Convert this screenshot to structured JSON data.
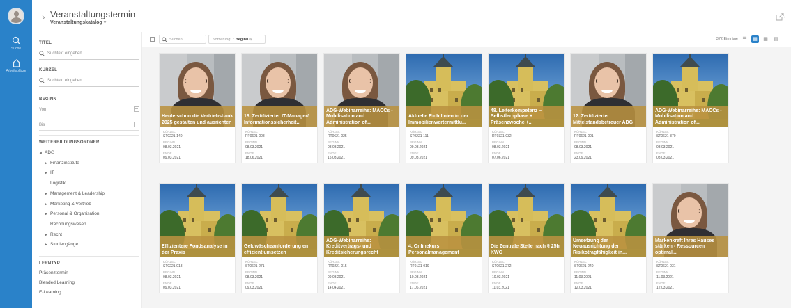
{
  "nav": {
    "search_label": "Suche",
    "workspace_label": "Arbeitsplätze"
  },
  "header": {
    "title": "Veranstaltungstermin",
    "subtitle": "Veranstaltungskatalog"
  },
  "filters": {
    "title_label": "TITEL",
    "title_placeholder": "Suchtext eingeben...",
    "kuerzel_label": "KÜRZEL",
    "kuerzel_placeholder": "Suchtext eingeben...",
    "begin_label": "BEGINN",
    "from_label": "Von",
    "to_label": "Bis",
    "folder_label": "WEITERBILDUNGSORDNER",
    "tree": [
      {
        "label": "ADG",
        "arrow": "◢",
        "level": 0
      },
      {
        "label": "Finanzinstitute",
        "arrow": "▶",
        "level": 1
      },
      {
        "label": "IT",
        "arrow": "▶",
        "level": 1
      },
      {
        "label": "Logistik",
        "arrow": "",
        "level": 1
      },
      {
        "label": "Management & Leadership",
        "arrow": "▶",
        "level": 1
      },
      {
        "label": "Marketing & Vertrieb",
        "arrow": "▶",
        "level": 1
      },
      {
        "label": "Personal & Organisation",
        "arrow": "▶",
        "level": 1
      },
      {
        "label": "Rechnungswesen",
        "arrow": "",
        "level": 1
      },
      {
        "label": "Recht",
        "arrow": "▶",
        "level": 1
      },
      {
        "label": "Studiengänge",
        "arrow": "▶",
        "level": 1
      }
    ],
    "lerntyp_label": "LERNTYP",
    "lerntyp_items": [
      "Präsenztermin",
      "Blended Learning",
      "E-Learning"
    ]
  },
  "toolbar": {
    "search_placeholder": "Suchen...",
    "sort_label": "Sortierung:",
    "sort_value": "↑ Beginn",
    "sort_clear": "⊗",
    "count": "372 Einträge"
  },
  "labels": {
    "kuerzel": "KÜRZEL",
    "beginn": "BEGINN",
    "ende": "ENDE"
  },
  "cards": [
    {
      "title": "Heute schon die Vertriebsbank 2025 gestalten und ausrichten",
      "scene": "person",
      "kuerzel": "ST0221-140",
      "beginn": "08.03.2021",
      "ende": "09.03.2021"
    },
    {
      "title": "18. Zertifizierter IT-Manager/ Informationssicherheit...",
      "scene": "person",
      "kuerzel": "RT0621-008",
      "beginn": "08.03.2021",
      "ende": "18.06.2021"
    },
    {
      "title": "ADG-Webinarreihe: MACCs - Mobilisation and Administration of...",
      "scene": "person",
      "kuerzel": "RT0621-025",
      "beginn": "08.03.2021",
      "ende": "15.03.2021"
    },
    {
      "title": "Aktuelle Richtlinien in der Immobilienwertermittlu...",
      "scene": "castle",
      "kuerzel": "ST0221-111",
      "beginn": "09.03.2021",
      "ende": "09.03.2021"
    },
    {
      "title": "48. Leiterkompetenz – Selbstlernphase + Präsenzwoche +...",
      "scene": "castle",
      "kuerzel": "RT0321-032",
      "beginn": "08.03.2021",
      "ende": "07.06.2021"
    },
    {
      "title": "12. Zertifizierter Mittelstandsbetreuer ADG",
      "scene": "person",
      "kuerzel": "RT0621-001",
      "beginn": "08.03.2021",
      "ende": "23.09.2021"
    },
    {
      "title": "ADG-Webinarreihe: MACCs - Mobilisation and Administration of...",
      "scene": "castle",
      "kuerzel": "ST0621-370",
      "beginn": "08.03.2021",
      "ende": "08.03.2021"
    },
    {
      "title": "Effizientere Fondsanalyse in der Praxis",
      "scene": "castle",
      "kuerzel": "ST0221-018",
      "beginn": "08.03.2021",
      "ende": "09.03.2021"
    },
    {
      "title": "Geldwäscheanforderung en effizient umsetzen",
      "scene": "castle",
      "kuerzel": "ST0621-271",
      "beginn": "08.03.2021",
      "ende": "09.03.2021"
    },
    {
      "title": "ADG-Webinarreihe: Kreditvertrags- und Kreditsicherungsrecht",
      "scene": "castle",
      "kuerzel": "RT0221-015",
      "beginn": "09.03.2021",
      "ende": "14.04.2021"
    },
    {
      "title": "4. Onlinekurs Personalmanagement",
      "scene": "castle",
      "kuerzel": "RT0121-019",
      "beginn": "10.03.2021",
      "ende": "17.06.2021"
    },
    {
      "title": "Die Zentrale Stelle nach § 25h KWG",
      "scene": "castle",
      "kuerzel": "ST0621-272",
      "beginn": "10.03.2021",
      "ende": "11.03.2021"
    },
    {
      "title": "Umsetzung der Neuausrichtung der Risikotragfähigkeit in...",
      "scene": "castle",
      "kuerzel": "ST0621-240",
      "beginn": "11.03.2021",
      "ende": "12.03.2021"
    },
    {
      "title": "Markenkraft Ihres Hauses stärken - Ressourcen optimal...",
      "scene": "person",
      "kuerzel": "ST0621-031",
      "beginn": "11.03.2021",
      "ende": "12.03.2021"
    }
  ]
}
